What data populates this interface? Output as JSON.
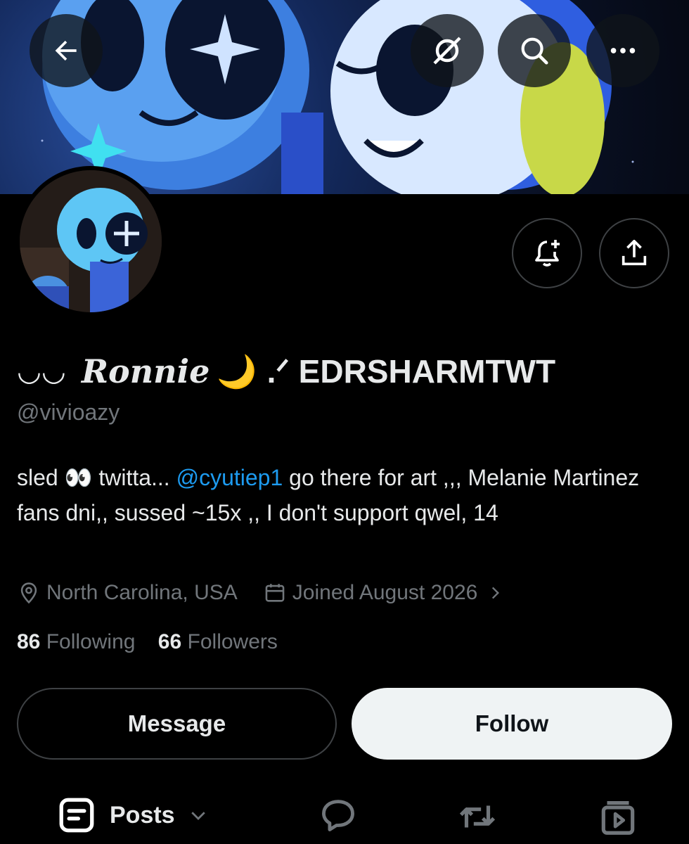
{
  "header": {
    "back_icon": "arrow-left-icon",
    "grok_icon": "slashed-circle-icon",
    "search_icon": "search-icon",
    "more_icon": "more-dots-icon"
  },
  "profile": {
    "name_prefix": "◡◡",
    "name_script": "Ronnie",
    "name_emoji": "🌙",
    "name_suffix": ".ᐟ EDRSHARMTWT",
    "handle": "@vivioazy",
    "bio_part1": "sled 👀 twitta... ",
    "bio_mention": "@cyutiep1",
    "bio_part2": " go there for art ,,, Melanie Martinez fans dni,, sussed ~15x ,, I don't support qwel, 14",
    "location": "North Carolina, USA",
    "joined": "Joined August 2026",
    "following_count": "86",
    "following_label": "Following",
    "followers_count": "66",
    "followers_label": "Followers"
  },
  "actions": {
    "notify_icon": "bell-plus-icon",
    "share_icon": "share-icon",
    "message_label": "Message",
    "follow_label": "Follow"
  },
  "tabs": {
    "posts_label": "Posts"
  },
  "colors": {
    "background": "#000000",
    "text_primary": "#e7e9ea",
    "text_secondary": "#71767b",
    "accent": "#1d9bf0",
    "follow_bg": "#eff3f4"
  }
}
